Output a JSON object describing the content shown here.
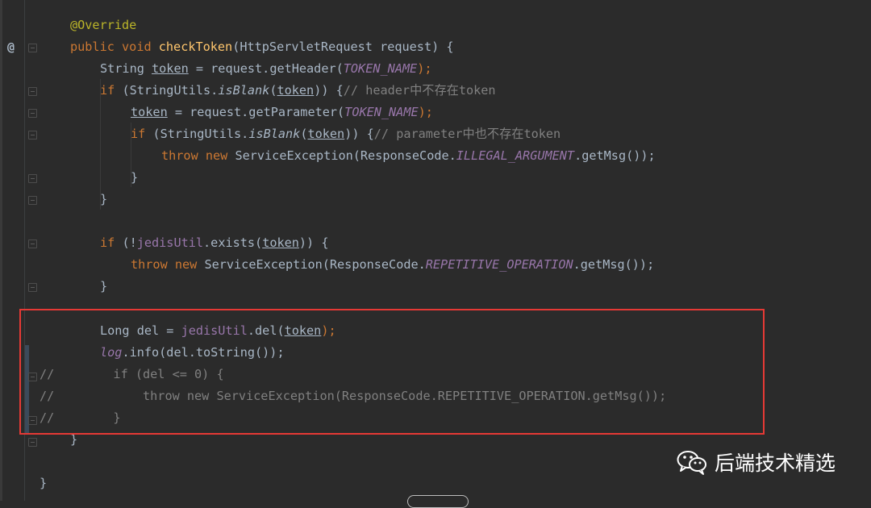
{
  "editor": {
    "gutter_marker": "@",
    "lines": {
      "l1": {
        "annotation": "@Override"
      },
      "l2": {
        "kw1": "public",
        "kw2": "void",
        "method": "checkToken",
        "rest": "(HttpServletRequest request) {"
      },
      "l3": {
        "a": "String ",
        "var": "token",
        "b": " = request.getHeader(",
        "const": "TOKEN_NAME",
        "c": ");"
      },
      "l4": {
        "kw": "if",
        "a": " (StringUtils.",
        "m": "isBlank",
        "b": "(",
        "var": "token",
        "c": ")) {",
        "comment": "// header中不存在token"
      },
      "l5": {
        "var": "token",
        "a": " = request.getParameter(",
        "const": "TOKEN_NAME",
        "b": ");"
      },
      "l6": {
        "kw": "if",
        "a": " (StringUtils.",
        "m": "isBlank",
        "b": "(",
        "var": "token",
        "c": ")) {",
        "comment": "// parameter中也不存在token"
      },
      "l7": {
        "kw1": "throw",
        "kw2": "new",
        "a": " ServiceException(ResponseCode.",
        "const": "ILLEGAL_ARGUMENT",
        "b": ".getMsg());"
      },
      "l8": {
        "text": "}"
      },
      "l9": {
        "text": "}"
      },
      "l10": {
        "kw": "if",
        "a": " (!",
        "field": "jedisUtil",
        "b": ".exists(",
        "var": "token",
        "c": ")) {"
      },
      "l11": {
        "kw1": "throw",
        "kw2": "new",
        "a": " ServiceException(ResponseCode.",
        "const": "REPETITIVE_OPERATION",
        "b": ".getMsg());"
      },
      "l12": {
        "text": "}"
      },
      "l13": {
        "a": "Long del = ",
        "field": "jedisUtil",
        "b": ".del(",
        "var": "token",
        "c": ");"
      },
      "l14": {
        "field": "log",
        "a": ".info(del.toString());"
      },
      "l15": {
        "text": "//        if (del <= 0) {"
      },
      "l16": {
        "text": "//            throw new ServiceException(ResponseCode.REPETITIVE_OPERATION.getMsg());"
      },
      "l17": {
        "text": "//        }"
      },
      "l18": {
        "text": "}"
      },
      "l19": {
        "text": "}"
      }
    }
  },
  "watermark": {
    "icon": "wechat-icon",
    "text": "后端技术精选"
  },
  "colors": {
    "background": "#2b2b2b",
    "keyword": "#cc7832",
    "highlight_box": "#e53935"
  }
}
